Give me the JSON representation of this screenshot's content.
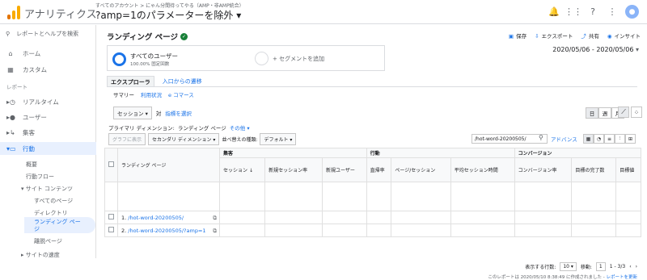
{
  "app": {
    "name": "アナリティクス",
    "breadcrumb": "すべてのアカウント > にゃん分間待ってやる（AMP・非AMP統合）",
    "view": "?amp=1のパラメーターを除外"
  },
  "colors": {
    "accent": "#1a73e8",
    "logo_orange": "#f9ab00",
    "logo_darkorange": "#e37400"
  },
  "sidebar": {
    "search": "レポートとヘルプを検索",
    "home": "ホーム",
    "custom": "カスタム",
    "reports_label": "レポート",
    "realtime": "リアルタイム",
    "users": "ユーザー",
    "acquisition": "集客",
    "behavior": "行動",
    "overview": "概要",
    "flow": "行動フロー",
    "site_content": "サイト コンテンツ",
    "all_pages": "すべてのページ",
    "directory": "ディレクトリ",
    "landing_pages": "ランディング ページ",
    "exit_pages": "離脱ページ",
    "site_speed": "サイトの速度"
  },
  "report": {
    "title": "ランディング ページ",
    "actions": {
      "save": "保存",
      "export": "エクスポート",
      "share": "共有",
      "insights": "インサイト"
    },
    "segment1_name": "すべてのユーザー",
    "segment1_sub": "100.00% 固定回数",
    "segment2": "+ セグメントを追加",
    "daterange": "2020/05/06 - 2020/05/06",
    "tabs": [
      "エクスプローラ",
      "入口からの遷移"
    ],
    "subtabs": [
      "サマリー",
      "利用状況",
      "e コマース"
    ],
    "metric_select": "セッション",
    "vs": "対",
    "metric_select2": "指標を選択",
    "view_buttons": [
      "日",
      "週",
      "月"
    ],
    "primary_dim_label": "プライマリ ディメンション:",
    "primary_dim_value": "ランディング ページ",
    "other": "その他",
    "toolbar": {
      "plot": "グラフに表示",
      "secondary": "セカンダリ ディメンション",
      "sort": "並べ替えの種類:",
      "default": "デフォルト"
    },
    "search_value": "/hot-word-20200505/",
    "advanced": "アドバンス",
    "table": {
      "groups": [
        "集客",
        "行動",
        "コンバージョン"
      ],
      "headers": [
        "ランディング ページ",
        "セッション",
        "新規セッション率",
        "新規ユーザー",
        "直帰率",
        "ページ/セッション",
        "平均セッション時間",
        "コンバージョン率",
        "目標の完了数",
        "目標値"
      ],
      "rows": [
        {
          "num": "1.",
          "page": "/hot-word-20200505/"
        },
        {
          "num": "2.",
          "page": "/hot-word-20200505/?amp=1"
        }
      ]
    },
    "footer": {
      "rows_label": "表示する行数:",
      "rows_value": "10",
      "goto_label": "移動:",
      "goto_value": "1",
      "range": "1 - 3/3",
      "created": "このレポートは 2020/05/10 8:38:49 に作成されました -",
      "refresh": "レポートを更新"
    }
  }
}
